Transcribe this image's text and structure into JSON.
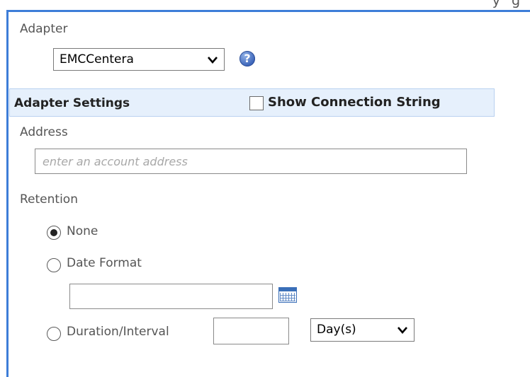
{
  "top_strip": {
    "text_fragment": "y",
    "text_fragment_right": "g"
  },
  "adapter": {
    "label": "Adapter",
    "selected": "EMCCentera",
    "help_icon": "help-question-icon"
  },
  "adapter_settings": {
    "title": "Adapter Settings",
    "show_connection_string_label": "Show Connection String",
    "show_connection_string_checked": false
  },
  "address": {
    "label": "Address",
    "placeholder": "enter an account address",
    "value": ""
  },
  "retention": {
    "label": "Retention",
    "options": {
      "none": "None",
      "date_format": "Date Format",
      "duration_interval": "Duration/Interval"
    },
    "selected": "none",
    "date_value": "",
    "calendar_icon": "calendar-icon",
    "duration_value": "",
    "unit_selected": "Day(s)"
  },
  "colors": {
    "accent_border": "#3d7dd8",
    "section_bg": "#e6f0fc"
  }
}
